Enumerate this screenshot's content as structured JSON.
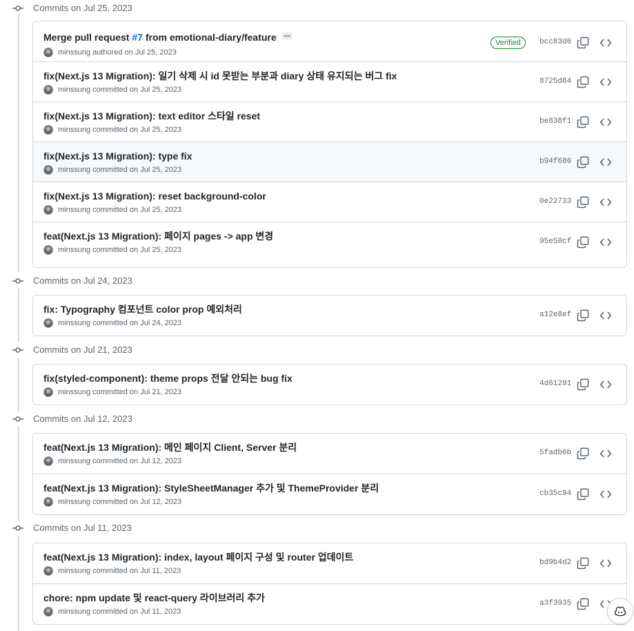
{
  "groups": [
    {
      "title": "Commits on Jul 25, 2023",
      "commits": [
        {
          "message": "Merge pull request ",
          "pr": "#7",
          "message_after": " from emotional-diary/feature",
          "author": "minssung",
          "action": "authored on Jul 25, 2023",
          "verified": "Verified",
          "sha": "bcc83d6"
        },
        {
          "message": "fix(Next.js 13 Migration): 일기 삭제 시 id 못받는 부분과 diary 상태 유지되는 버그 fix",
          "author": "minssung",
          "action": "committed on Jul 25, 2023",
          "sha": "8725d64"
        },
        {
          "message": "fix(Next.js 13 Migration): text editor 스타일 reset",
          "author": "minssung",
          "action": "committed on Jul 25, 2023",
          "sha": "be838f1"
        },
        {
          "message": "fix(Next.js 13 Migration): type fix",
          "author": "minssung",
          "action": "committed on Jul 25, 2023",
          "sha": "b94f686"
        },
        {
          "message": "fix(Next.js 13 Migration): reset background-color",
          "author": "minssung",
          "action": "committed on Jul 25, 2023",
          "sha": "0e22733"
        },
        {
          "message": "feat(Next.js 13 Migration): 페이지 pages -> app 변경",
          "author": "minssung",
          "action": "committed on Jul 25, 2023",
          "sha": "95e50cf"
        }
      ]
    },
    {
      "title": "Commits on Jul 24, 2023",
      "commits": [
        {
          "message": "fix: Typography 컴포넌트 color prop 예외처리",
          "author": "minssung",
          "action": "committed on Jul 24, 2023",
          "sha": "a12e8ef"
        }
      ]
    },
    {
      "title": "Commits on Jul 21, 2023",
      "commits": [
        {
          "message": "fix(styled-component): theme props 전달 안되는 bug fix",
          "author": "minssung",
          "action": "committed on Jul 21, 2023",
          "sha": "4d61291"
        }
      ]
    },
    {
      "title": "Commits on Jul 12, 2023",
      "commits": [
        {
          "message": "feat(Next.js 13 Migration): 메인 페이지 Client, Server 분리",
          "author": "minssung",
          "action": "committed on Jul 12, 2023",
          "sha": "5fadb0b"
        },
        {
          "message": "feat(Next.js 13 Migration): StyleSheetManager 추가 및 ThemeProvider 분리",
          "author": "minssung",
          "action": "committed on Jul 12, 2023",
          "sha": "cb35c94"
        }
      ]
    },
    {
      "title": "Commits on Jul 11, 2023",
      "commits": [
        {
          "message": "feat(Next.js 13 Migration): index, layout 페이지 구성 및 router 업데이트",
          "author": "minssung",
          "action": "committed on Jul 11, 2023",
          "sha": "bd9b4d2"
        },
        {
          "message": "chore: npm update 및 react-query 라이브러리 추가",
          "author": "minssung",
          "action": "committed on Jul 11, 2023",
          "sha": "a3f3935"
        }
      ]
    }
  ],
  "icons": {
    "commit": "git-commit-icon",
    "copy": "copy-icon",
    "browse": "code-icon",
    "more": "ellipsis-icon",
    "assistant": "copilot-icon"
  },
  "colors": {
    "link": "#0969da",
    "verified": "#1a7f37",
    "muted": "#59636e",
    "border": "#d0d7de"
  }
}
